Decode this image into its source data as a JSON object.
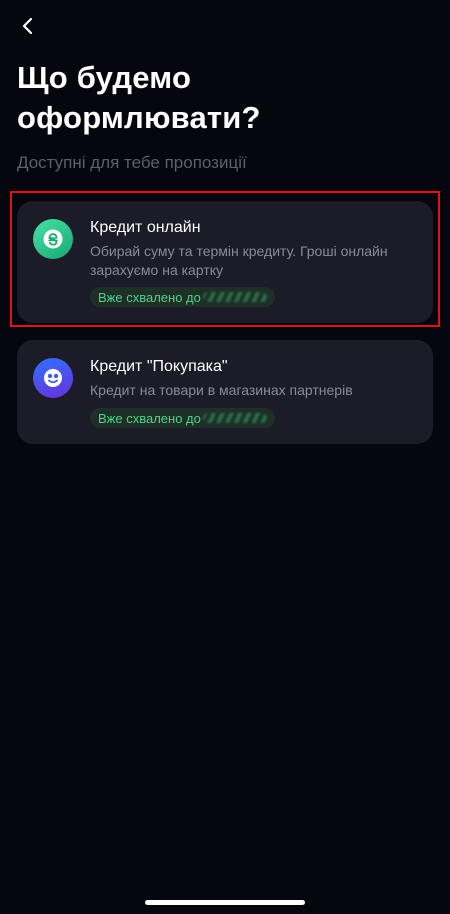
{
  "header": {
    "back_icon": "chevron-left-icon",
    "title": "Що будемо оформлювати?",
    "subtitle": "Доступні для тебе пропозиції"
  },
  "offers": [
    {
      "title": "Кредит онлайн",
      "description": "Обирай суму та термін кредиту. Гроші онлайн зарахуємо на картку",
      "badge": "Вже схвалено до",
      "icon": "hryvnia-coin-icon",
      "icon_color": "#2ec98f",
      "highlighted": true
    },
    {
      "title": "Кредит \"Покупака\"",
      "description": "Кредит на товари в магазинах партнерів",
      "badge": "Вже схвалено до",
      "icon": "smiley-face-icon",
      "icon_color": "#3f5cf0",
      "highlighted": false
    }
  ],
  "colors": {
    "background": "#06060f",
    "card": "#1c1b28",
    "badge_text": "#4fd38a",
    "highlight": "#e0121b"
  }
}
